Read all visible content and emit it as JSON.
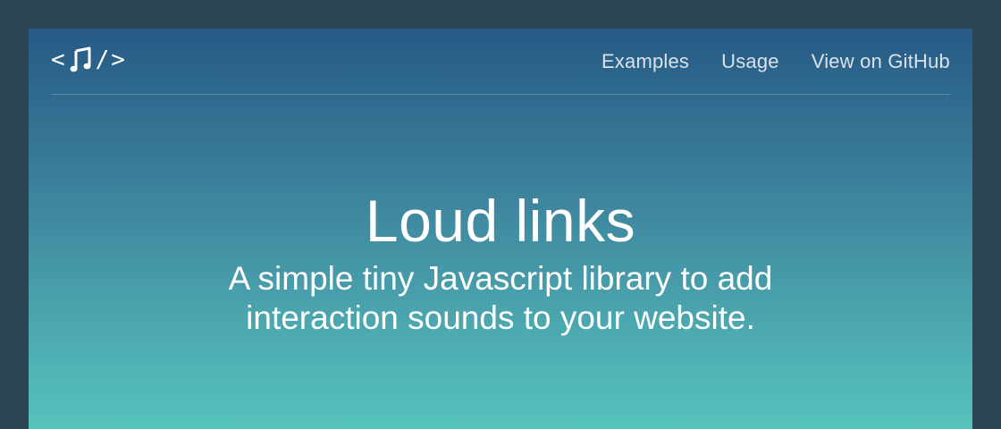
{
  "logo": {
    "left": "<",
    "right": "/>",
    "icon": "music-note-icon"
  },
  "nav": {
    "links": [
      {
        "label": "Examples"
      },
      {
        "label": "Usage"
      },
      {
        "label": "View on GitHub"
      }
    ]
  },
  "hero": {
    "title": "Loud links",
    "subtitle": "A simple tiny Javascript library to add interaction sounds to your website."
  },
  "colors": {
    "page_background": "#2a4556",
    "gradient_top": "#265a85",
    "gradient_bottom": "#56c3bc",
    "text": "#ffffff"
  }
}
